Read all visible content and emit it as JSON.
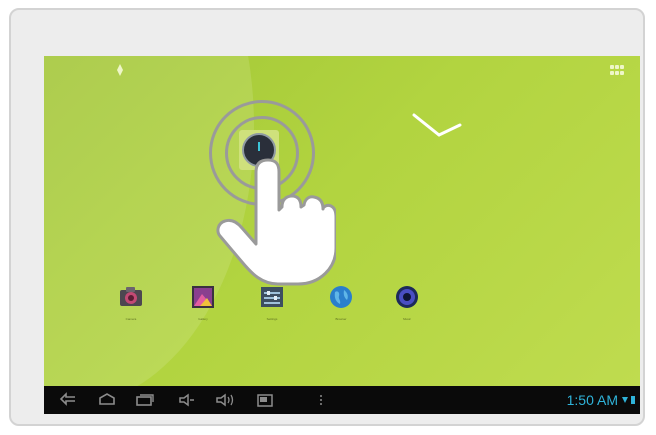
{
  "status_bar": {
    "time": "1:50 AM"
  },
  "home": {
    "highlighted_app": "clock-app",
    "dock_apps": [
      {
        "icon": "camera-icon",
        "label": "Camera"
      },
      {
        "icon": "gallery-icon",
        "label": "Gallery"
      },
      {
        "icon": "settings-icon",
        "label": "Settings"
      },
      {
        "icon": "browser-icon",
        "label": "Browser"
      },
      {
        "icon": "music-icon",
        "label": "Music"
      }
    ]
  },
  "navigation_bar": {
    "buttons": [
      "back-icon",
      "home-icon",
      "recent-apps-icon",
      "volume-down-icon",
      "volume-up-icon",
      "screenshot-icon",
      "menu-icon"
    ]
  },
  "colors": {
    "wallpaper": "#b2d440",
    "navbar": "#0a0a0a",
    "clock_text": "#2fb3d9"
  }
}
